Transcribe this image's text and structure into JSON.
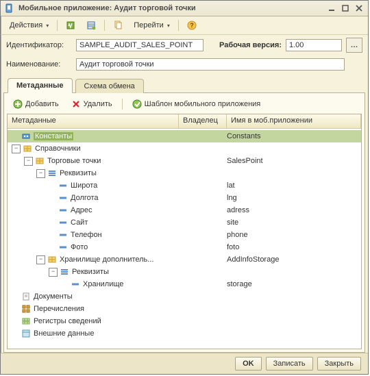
{
  "window_title": "Мобильное приложение: Аудит торговой точки",
  "toolbar": {
    "actions_label": "Действия",
    "go_label": "Перейти"
  },
  "form": {
    "ident_label": "Идентификатор:",
    "ident_value": "SAMPLE_AUDIT_SALES_POINT",
    "version_label": "Рабочая версия:",
    "version_value": "1.00",
    "name_label": "Наименование:",
    "name_value": "Аудит торговой точки"
  },
  "tabs": {
    "metadata": "Метаданные",
    "exchange": "Схема обмена"
  },
  "inner_tb": {
    "add": "Добавить",
    "delete": "Удалить",
    "template": "Шаблон мобильного приложения"
  },
  "columns": {
    "metadata": "Метаданные",
    "owner": "Владелец",
    "app_name": "Имя в моб.приложении"
  },
  "tree": [
    {
      "indent": 0,
      "exp": "",
      "icon": "const",
      "label": "Константы",
      "app": "Constants",
      "selected": true
    },
    {
      "indent": 0,
      "exp": "-",
      "icon": "ref",
      "label": "Справочники",
      "app": ""
    },
    {
      "indent": 1,
      "exp": "-",
      "icon": "ref",
      "label": "Торговые точки",
      "app": "SalesPoint"
    },
    {
      "indent": 2,
      "exp": "-",
      "icon": "attrgroup",
      "label": "Реквизиты",
      "app": ""
    },
    {
      "indent": 3,
      "exp": "",
      "icon": "attr",
      "label": "Широта",
      "app": "lat"
    },
    {
      "indent": 3,
      "exp": "",
      "icon": "attr",
      "label": "Долгота",
      "app": "lng"
    },
    {
      "indent": 3,
      "exp": "",
      "icon": "attr",
      "label": "Адрес",
      "app": "adress"
    },
    {
      "indent": 3,
      "exp": "",
      "icon": "attr",
      "label": "Сайт",
      "app": "site"
    },
    {
      "indent": 3,
      "exp": "",
      "icon": "attr",
      "label": "Телефон",
      "app": "phone"
    },
    {
      "indent": 3,
      "exp": "",
      "icon": "attr",
      "label": "Фото",
      "app": "foto"
    },
    {
      "indent": 2,
      "exp": "-",
      "icon": "ref",
      "label": "Хранилище дополнитель...",
      "app": "AddInfoStorage"
    },
    {
      "indent": 3,
      "exp": "-",
      "icon": "attrgroup",
      "label": "Реквизиты",
      "app": ""
    },
    {
      "indent": 4,
      "exp": "",
      "icon": "attr",
      "label": "Хранилище",
      "app": "storage"
    },
    {
      "indent": 0,
      "exp": "",
      "icon": "doc",
      "label": "Документы",
      "app": ""
    },
    {
      "indent": 0,
      "exp": "",
      "icon": "enum",
      "label": "Перечисления",
      "app": ""
    },
    {
      "indent": 0,
      "exp": "",
      "icon": "reg",
      "label": "Регистры сведений",
      "app": ""
    },
    {
      "indent": 0,
      "exp": "",
      "icon": "ext",
      "label": "Внешние данные",
      "app": ""
    }
  ],
  "footer": {
    "ok": "OK",
    "write": "Записать",
    "close": "Закрыть"
  },
  "icons": {
    "const": {
      "bg": "#5a8fd6",
      "fg": "#fff"
    },
    "ref": {
      "bg": "#f2c349",
      "fg": "#a06a00"
    },
    "attrgroup": {
      "bg": "#7fb3e0",
      "fg": "#2a5f99"
    },
    "attr": {
      "bg": "#5a8fd6",
      "fg": "#fff"
    },
    "doc": {
      "bg": "#e8e8e8",
      "fg": "#888"
    },
    "enum": {
      "bg": "#d9a14a",
      "fg": "#fff"
    },
    "reg": {
      "bg": "#c7e0a9",
      "fg": "#5b8a2b"
    },
    "ext": {
      "bg": "#b7d8e8",
      "fg": "#2a6f99"
    }
  }
}
